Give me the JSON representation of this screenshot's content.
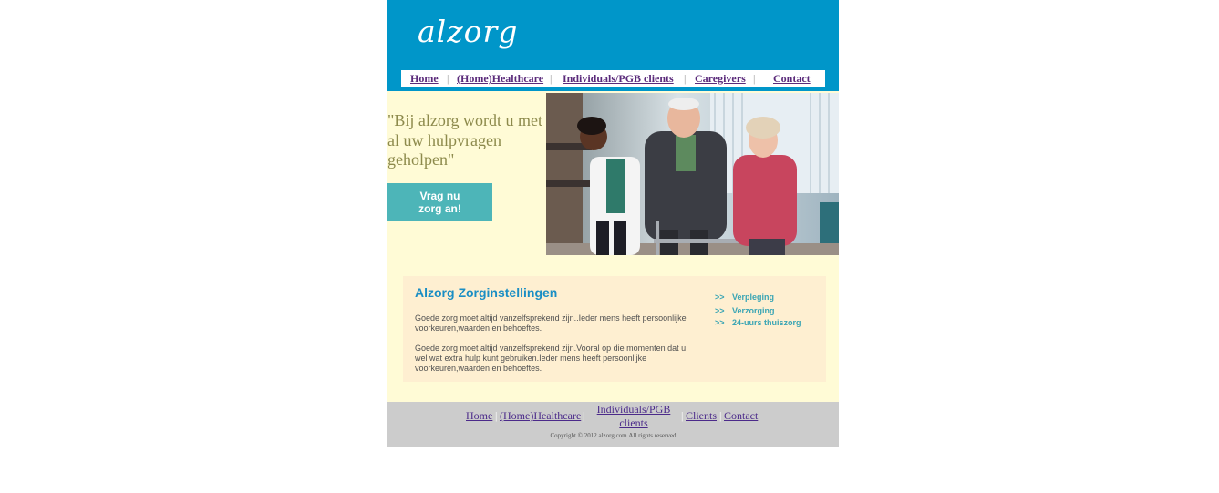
{
  "brand": {
    "logo_text": "alzorg"
  },
  "top_nav": {
    "items": [
      {
        "label": "Home"
      },
      {
        "label": "(Home)Healthcare"
      },
      {
        "label": "Individuals/PGB clients"
      },
      {
        "label": "Caregivers"
      },
      {
        "label": "Contact"
      }
    ],
    "separator": "|"
  },
  "hero": {
    "quote": "\"Bij alzorg wordt u met al uw hulpvragen geholpen\"",
    "cta_line1": "Vrag nu",
    "cta_line2": "zorg an!",
    "photo_icon": "care-photo-icon"
  },
  "info": {
    "title": "Alzorg Zorginstellingen",
    "paragraph1": "Goede zorg moet altijd vanzelfsprekend zijn..Ieder mens heeft persoonlijke voorkeuren,waarden en behoeftes.",
    "paragraph2": "Goede zorg moet altijd vanzelfsprekend zijn.Vooral op die momenten dat u wel wat extra hulp kunt gebruiken.Ieder mens heeft persoonlijke voorkeuren,waarden en behoeftes.",
    "services": [
      {
        "arrow": ">>",
        "label": "Verpleging"
      },
      {
        "arrow": ">>",
        "label": "Verzorging"
      },
      {
        "arrow": ">>",
        "label": "24-uurs thuiszorg"
      }
    ]
  },
  "footer": {
    "links": [
      {
        "label": "Home"
      },
      {
        "label": "(Home)Healthcare"
      },
      {
        "label": "Individuals/PGB clients"
      },
      {
        "label": "Clients"
      },
      {
        "label": "Contact"
      }
    ],
    "separator": "|",
    "copyright": "Copyright © 2012 alzorg.com.All rights reserved"
  },
  "colors": {
    "header_bg": "#0096c9",
    "hero_bg": "#fffbd6",
    "cta_bg": "#4db5b8",
    "info_bg": "#feefd1",
    "footer_bg": "#cccccc",
    "nav_link": "#5a2a7a"
  }
}
